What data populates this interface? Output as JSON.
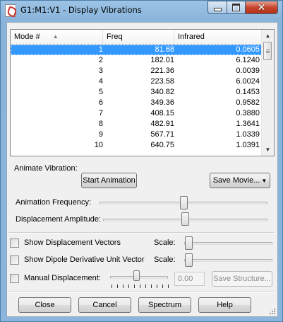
{
  "window": {
    "title": "G1:M1:V1 - Display Vibrations",
    "close_glyph": "✕"
  },
  "list": {
    "columns": [
      "Mode #",
      "Freq",
      "Infrared"
    ],
    "sort_glyph": "▲",
    "rows": [
      {
        "mode": "1",
        "freq": "81.68",
        "ir": "0.0605",
        "selected": true
      },
      {
        "mode": "2",
        "freq": "182.01",
        "ir": "6.1240"
      },
      {
        "mode": "3",
        "freq": "221.36",
        "ir": "0.0039"
      },
      {
        "mode": "4",
        "freq": "223.58",
        "ir": "6.0024"
      },
      {
        "mode": "5",
        "freq": "340.82",
        "ir": "0.1453"
      },
      {
        "mode": "6",
        "freq": "349.36",
        "ir": "0.9582"
      },
      {
        "mode": "7",
        "freq": "408.15",
        "ir": "0.3880"
      },
      {
        "mode": "8",
        "freq": "482.91",
        "ir": "1.3641"
      },
      {
        "mode": "9",
        "freq": "567.71",
        "ir": "1.0339"
      },
      {
        "mode": "10",
        "freq": "640.75",
        "ir": "1.0391"
      }
    ],
    "scroll_up_glyph": "▲",
    "scroll_down_glyph": "▼"
  },
  "animate": {
    "label": "Animate Vibration:",
    "start_button": "Start Animation",
    "save_movie_button": "Save Movie...",
    "dropdown_glyph": "▼",
    "frequency_label": "Animation Frequency:",
    "frequency_level": 0.5,
    "amplitude_label": "Displacement Amplitude:",
    "amplitude_level": 0.5
  },
  "options": {
    "show_vectors_label": "Show Displacement Vectors",
    "show_vectors_checked": false,
    "vectors_scale_label": "Scale:",
    "show_dipole_label": "Show Dipole Derivative Unit Vector",
    "show_dipole_checked": false,
    "dipole_scale_label": "Scale:",
    "manual_label": "Manual Displacement:",
    "manual_checked": false,
    "manual_value": "0.00",
    "save_structure_button": "Save Structure..."
  },
  "footer": {
    "close_button": "Close",
    "cancel_button": "Cancel",
    "spectrum_button": "Spectrum",
    "help_button": "Help"
  },
  "colors": {
    "selection": "#3399ff",
    "title_bar": "#9cc3e5",
    "close_button": "#c7452d"
  },
  "icons": {
    "app": "gaussview-app-icon",
    "minimize": "minimize-icon",
    "maximize": "maximize-icon",
    "close": "close-icon"
  }
}
